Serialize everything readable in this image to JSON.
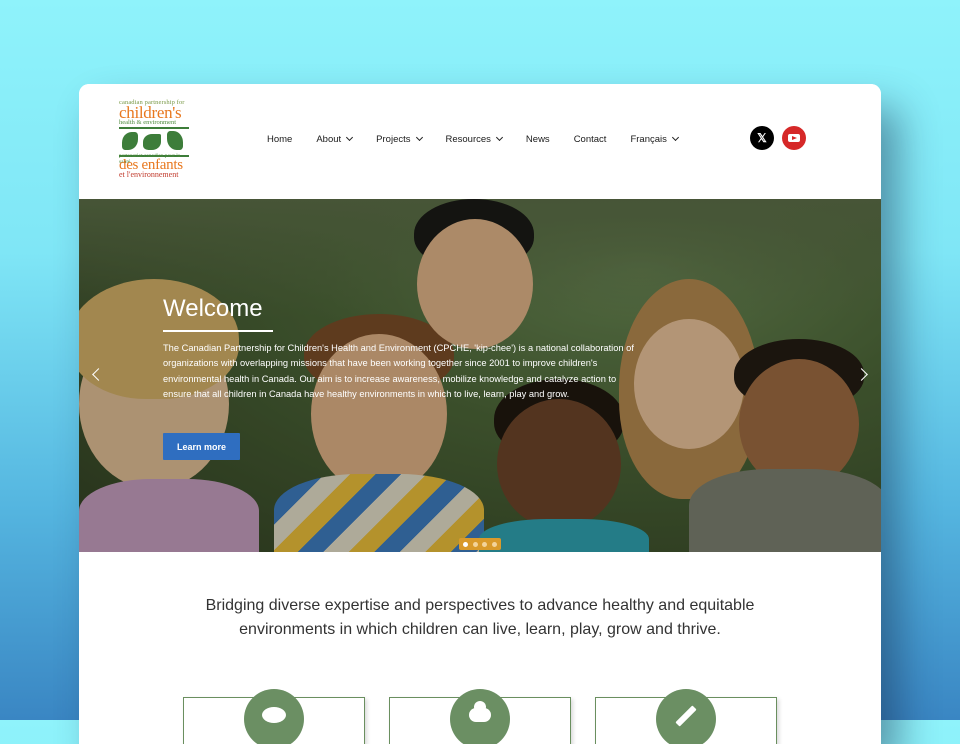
{
  "logo": {
    "line1": "canadian partnership for",
    "line2": "children's",
    "line3": "health & environment",
    "line4": "partenariat canadien pour la santé",
    "line5": "des enfants",
    "line6": "et l'environnement"
  },
  "nav": {
    "items": [
      {
        "label": "Home",
        "has_menu": false
      },
      {
        "label": "About",
        "has_menu": true
      },
      {
        "label": "Projects",
        "has_menu": true
      },
      {
        "label": "Resources",
        "has_menu": true
      },
      {
        "label": "News",
        "has_menu": false
      },
      {
        "label": "Contact",
        "has_menu": false
      },
      {
        "label": "Français",
        "has_menu": true
      }
    ]
  },
  "social": {
    "x_glyph": "𝕏",
    "x_icon": "x-logo-icon",
    "youtube_icon": "youtube-icon",
    "x_color": "#000000",
    "youtube_color": "#d62828"
  },
  "hero": {
    "title": "Welcome",
    "text": "The Canadian Partnership for Children's Health and Environment (CPCHE, 'kip-chee') is a national collaboration of organizations with overlapping missions that have been working together since 2001 to improve children's environmental health in Canada. Our aim is to increase awareness, mobilize knowledge and catalyze action to ensure that all children in Canada have healthy environments in which to live, learn, play and grow.",
    "button_label": "Learn more",
    "button_color": "#2f6ec0",
    "slides_total": 4,
    "active_slide": 1
  },
  "tagline": "Bridging diverse expertise and perspectives to advance healthy and equitable environments in which children can live, learn, play, grow and thrive.",
  "features": [
    {
      "icon": "chat-bubble-icon"
    },
    {
      "icon": "cloud-icon"
    },
    {
      "icon": "pencil-icon"
    }
  ],
  "colors": {
    "accent_green": "#6b8f63",
    "brand_orange": "#e8781f"
  }
}
